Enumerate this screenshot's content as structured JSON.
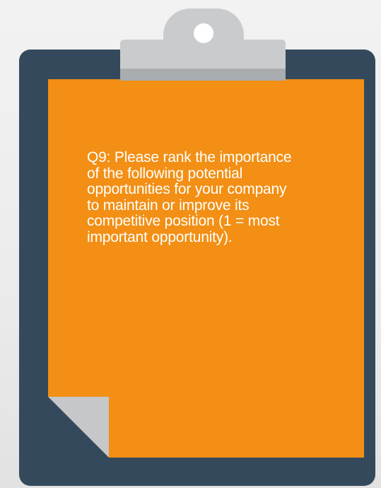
{
  "question": {
    "text": "Q9: Please rank the importance of the following potential opportunities for your company to maintain or improve its competitive position (1 = most important opportunity)."
  },
  "colors": {
    "background": "#efefef",
    "board": "#344a5c",
    "note": "#f28f14",
    "clip": "#c9cbcd",
    "clip_shadow": "#a9adb0",
    "fold": "#c5c7c9"
  },
  "icons": {
    "clip": "clipboard-clip-icon",
    "fold": "page-fold-icon"
  }
}
